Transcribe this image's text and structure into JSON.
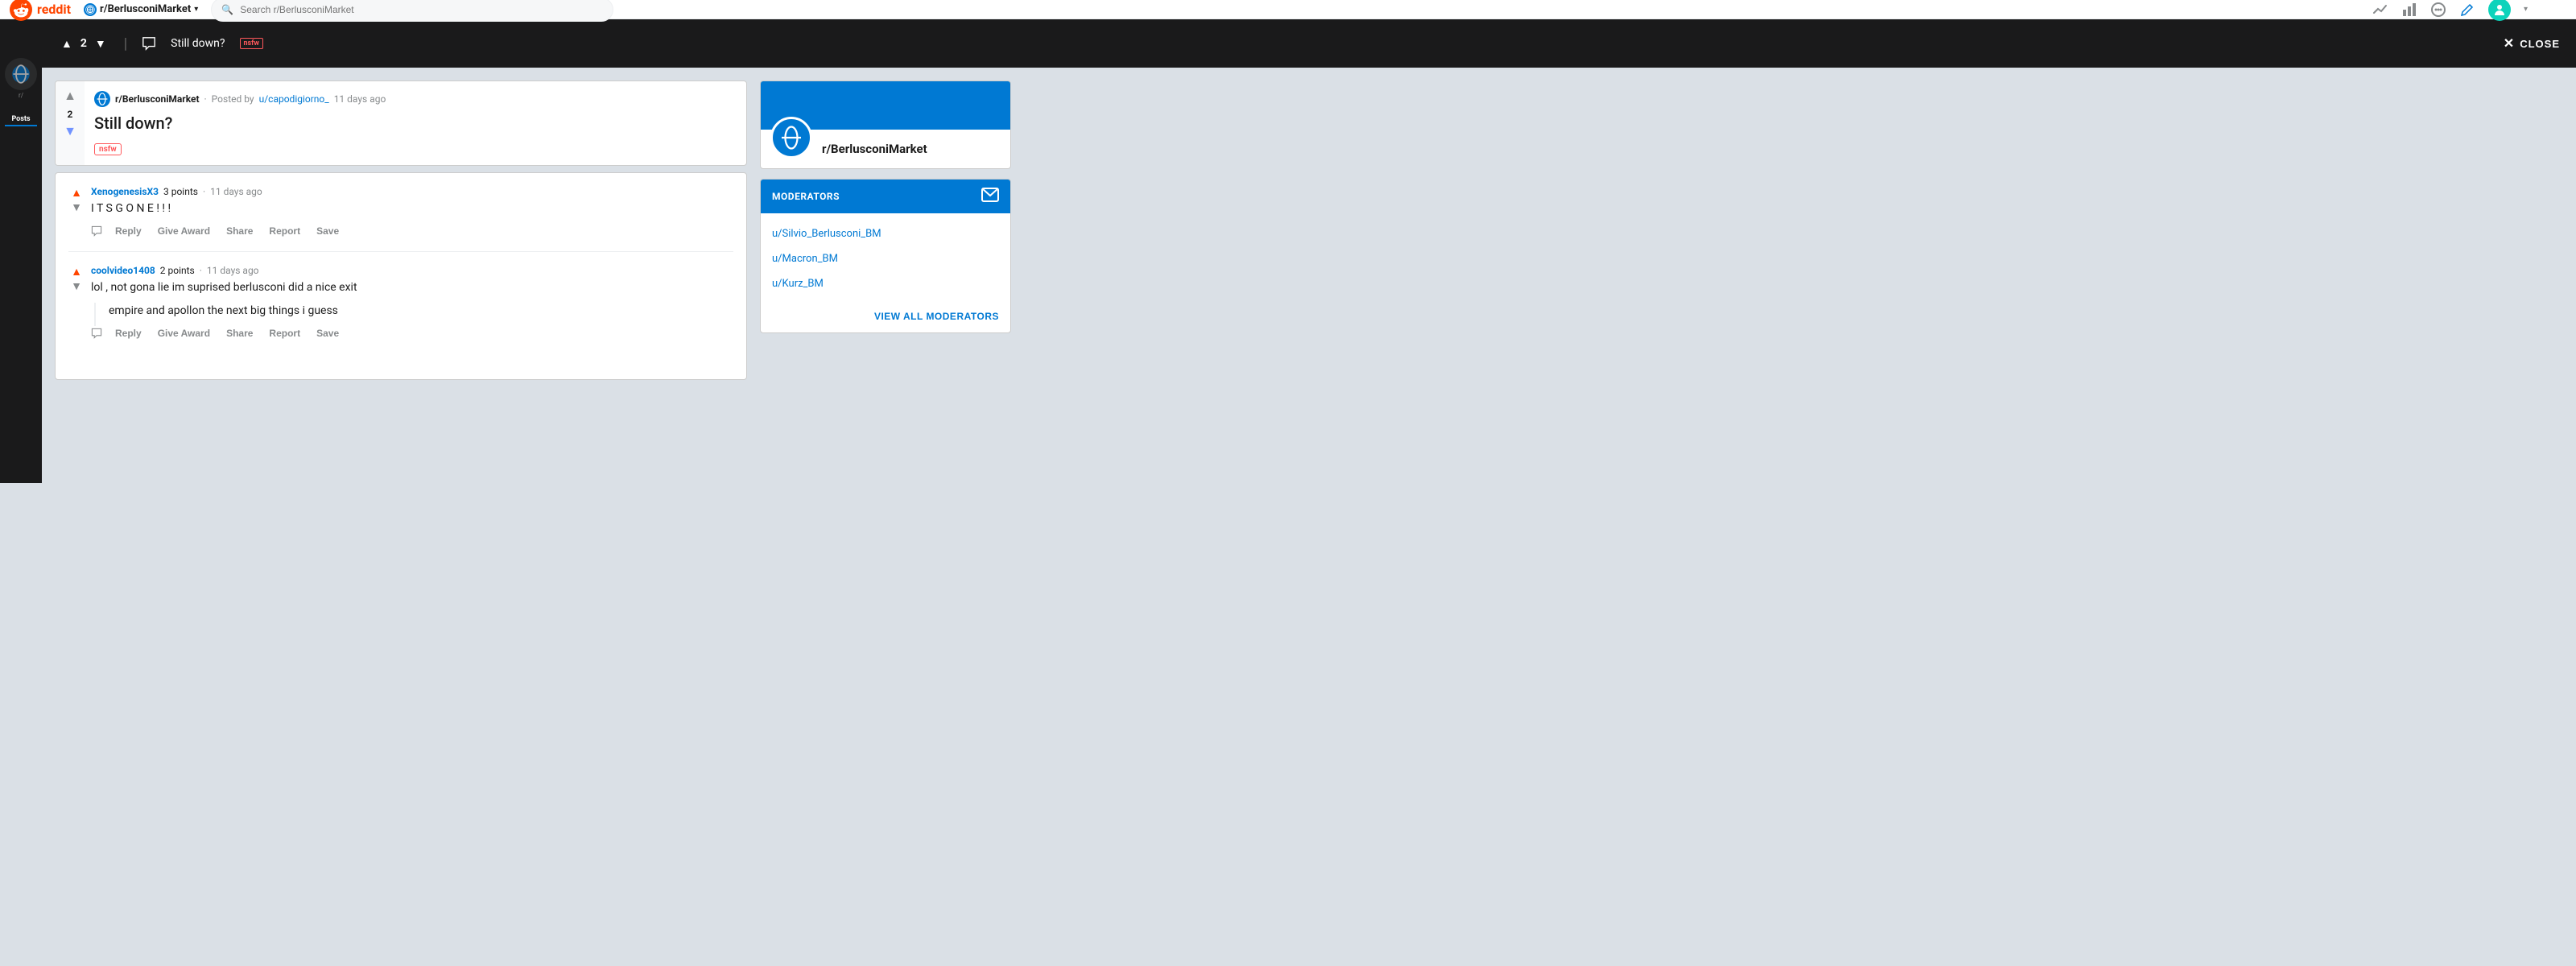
{
  "navbar": {
    "reddit_text": "reddit",
    "subreddit_name": "r/BerlusconiMarket",
    "search_placeholder": "Search r/BerlusconiMarket",
    "dropdown_arrow": "▾"
  },
  "black_bar": {
    "vote_count": "2",
    "post_title": "Still down?",
    "nsfw_label": "nsfw",
    "close_label": "CLOSE"
  },
  "post": {
    "subreddit": "r/BerlusconiMarket",
    "posted_by": "Posted by",
    "author": "u/capodigiorno_",
    "time": "11 days ago",
    "title": "Still down?",
    "nsfw_label": "nsfw",
    "vote_count": "2"
  },
  "comments": [
    {
      "author": "XenogenesisX3",
      "points": "3 points",
      "time": "11 days ago",
      "text": "I T S G O N E ! ! !",
      "actions": [
        "Reply",
        "Give Award",
        "Share",
        "Report",
        "Save"
      ]
    },
    {
      "author": "coolvideo1408",
      "points": "2 points",
      "time": "11 days ago",
      "text_line1": "lol , not gona lie im suprised berlusconi did a nice exit",
      "text_line2": "empire and apollon the next big things i guess",
      "actions": [
        "Reply",
        "Give Award",
        "Share",
        "Report",
        "Save"
      ]
    }
  ],
  "sidebar": {
    "subreddit_name": "r/BerlusconiMarket",
    "moderators_title": "MODERATORS",
    "mods": [
      "u/Silvio_Berlusconi_BM",
      "u/Macron_BM",
      "u/Kurz_BM"
    ],
    "view_all_label": "VIEW ALL MODERATORS"
  },
  "left_nav": {
    "posts_label": "Posts"
  }
}
